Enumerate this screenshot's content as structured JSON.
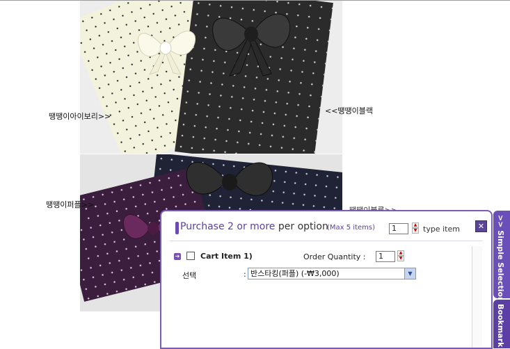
{
  "captions": {
    "ivory": "땡땡이아이보리>>",
    "black": "<<땡땡이블랙",
    "purple": "땡땡이퍼플>>",
    "partial": "땡땡이블루>>"
  },
  "panel": {
    "title_main": "Purchase 2 or more",
    "title_suffix": " per option",
    "max_note": "(Max 5 items)",
    "type_qty": "1",
    "type_item_label": "type item",
    "close_glyph": "✕"
  },
  "cart_item": {
    "label": "Cart Item 1)",
    "order_quantity_label": "Order Quantity :",
    "quantity": "1",
    "select_label": "선택",
    "select_colon": ":",
    "select_value": "반스타킹(퍼플) (-₩3,000)"
  },
  "side_tabs": {
    "simple_selection": ">> Simple Selection",
    "bookmark": "Bookmark"
  },
  "colors": {
    "accent": "#6b4fb8",
    "panel_border": "#7b5bb8"
  }
}
